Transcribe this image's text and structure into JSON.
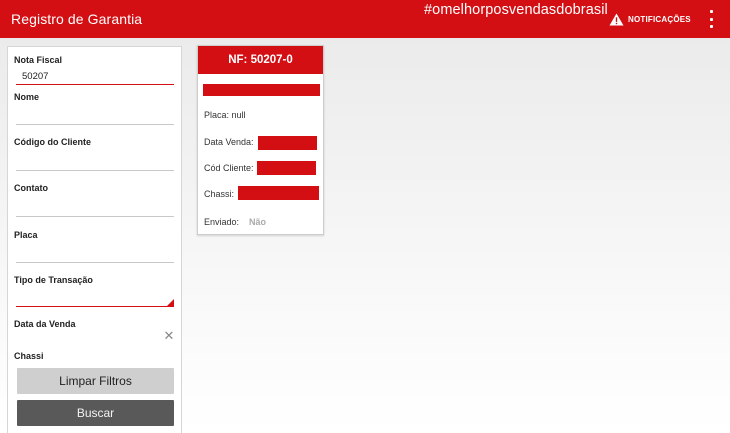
{
  "appbar": {
    "title": "Registro de Garantia",
    "hashtag": "#omelhorposvendasdobrasil",
    "notifications_label": "NOTIFICAÇÕES",
    "warning_icon": "warning-icon",
    "menu_icon": "kebab-menu-icon",
    "color": "#d40f14"
  },
  "filters": {
    "nota_fiscal": {
      "label": "Nota Fiscal",
      "value": "50207"
    },
    "nome": {
      "label": "Nome",
      "value": ""
    },
    "codigo_cliente": {
      "label": "Código do Cliente",
      "value": ""
    },
    "contato": {
      "label": "Contato",
      "value": ""
    },
    "placa": {
      "label": "Placa",
      "value": ""
    },
    "tipo_transacao": {
      "label": "Tipo de Transação",
      "value": ""
    },
    "data_venda": {
      "label": "Data da Venda",
      "clear_icon": "close-icon"
    },
    "chassi": {
      "label": "Chassi"
    },
    "clear_button": "Limpar Filtros",
    "search_button": "Buscar"
  },
  "result_card": {
    "title": "NF: 50207-0",
    "placa": "Placa: null",
    "data_venda_label": "Data Venda:",
    "cod_cliente_label": "Cód Cliente:",
    "chassi_label": "Chassi:",
    "enviado_label": "Enviado:",
    "enviado_value": "Não"
  }
}
